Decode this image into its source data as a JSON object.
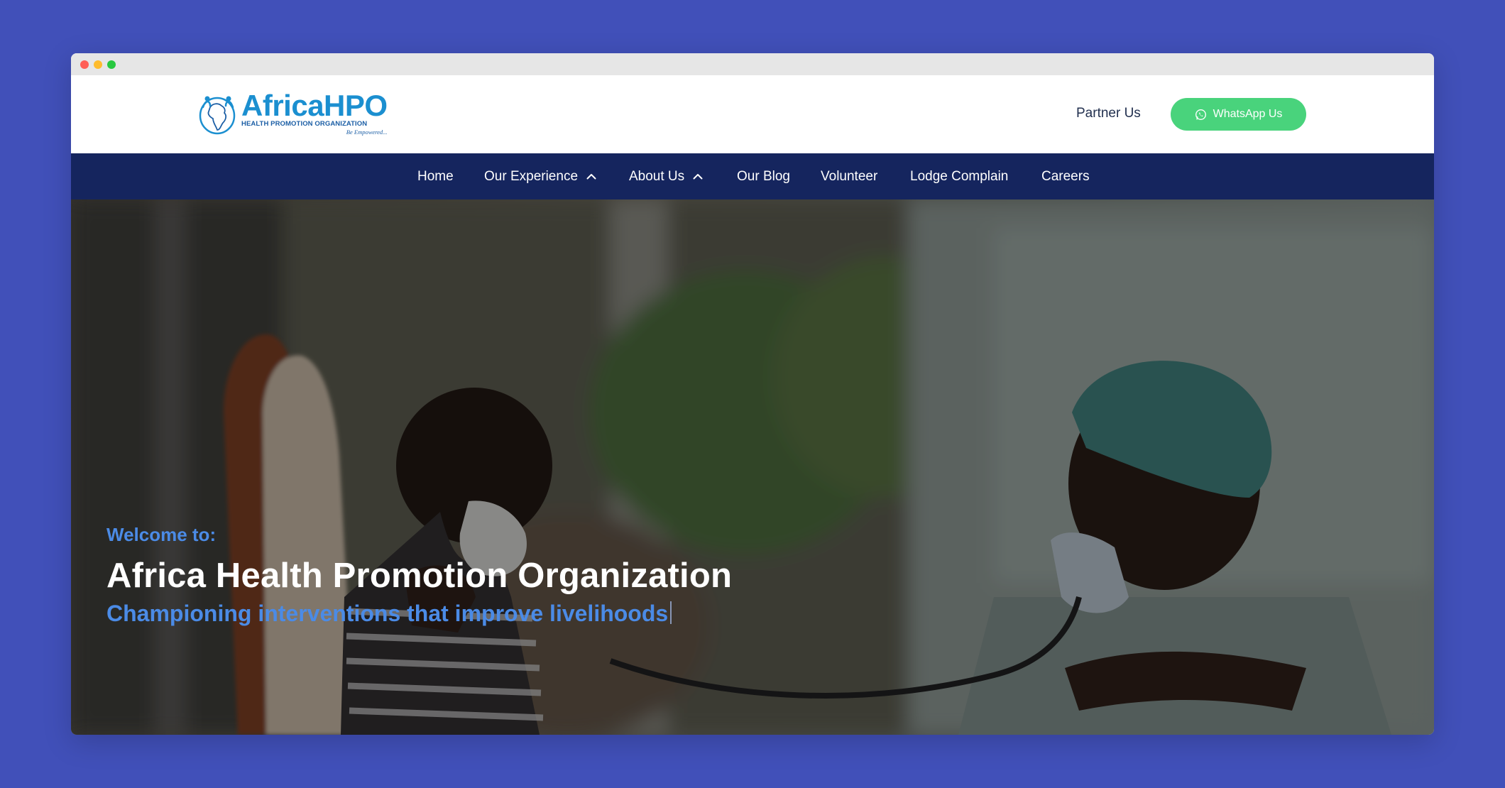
{
  "window": {
    "controls": [
      "close",
      "minimize",
      "zoom"
    ]
  },
  "header": {
    "logo": {
      "name": "AfricaHPO",
      "subtitle": "HEALTH PROMOTION ORGANIZATION",
      "tagline": "Be Empowered..."
    },
    "partner_label": "Partner Us",
    "whatsapp_label": "WhatsApp Us",
    "whatsapp_color": "#49d37c"
  },
  "nav": {
    "background": "#15255e",
    "items": [
      {
        "label": "Home",
        "has_dropdown": false
      },
      {
        "label": "Our Experience",
        "has_dropdown": true
      },
      {
        "label": "About Us",
        "has_dropdown": true
      },
      {
        "label": "Our Blog",
        "has_dropdown": false
      },
      {
        "label": "Volunteer",
        "has_dropdown": false
      },
      {
        "label": "Lodge Complain",
        "has_dropdown": false
      },
      {
        "label": "Careers",
        "has_dropdown": false
      }
    ]
  },
  "hero": {
    "welcome": "Welcome to:",
    "title": "Africa Health Promotion Organization",
    "tagline": "Championing interventions that improve livelihoods",
    "accent": "#4b8be6"
  }
}
